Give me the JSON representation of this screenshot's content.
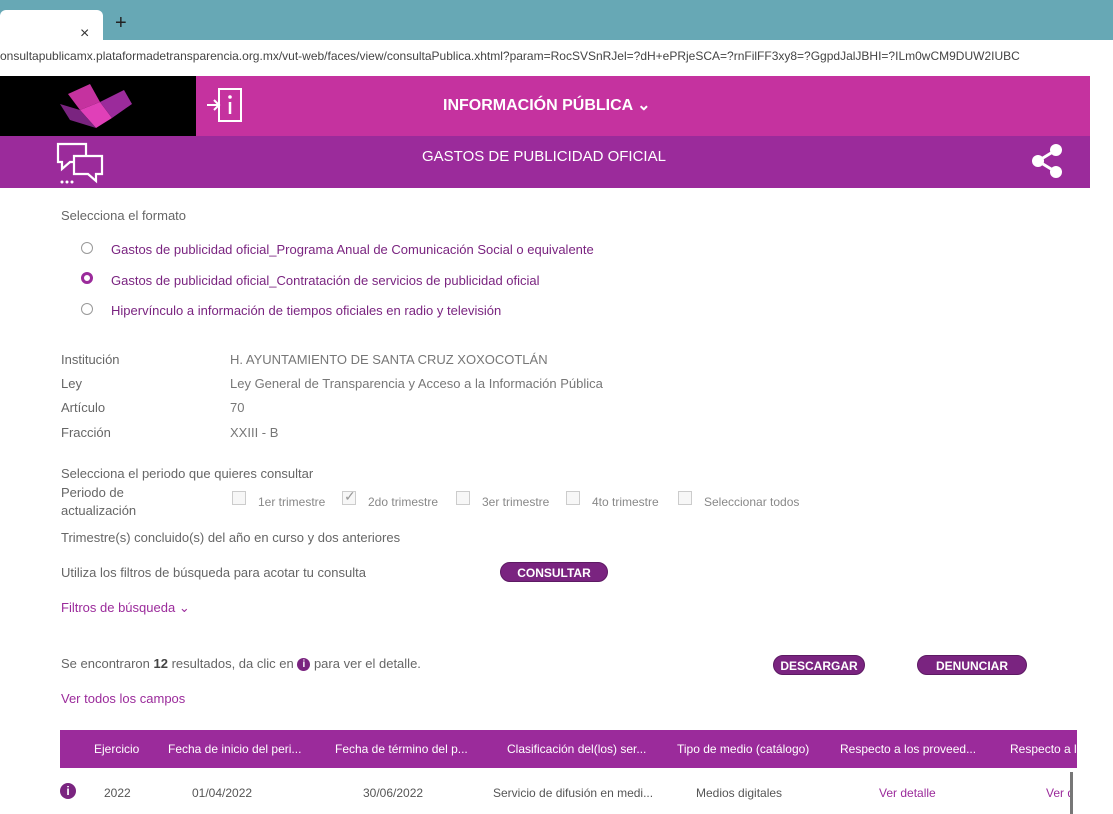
{
  "browser": {
    "tab_close": "×",
    "new_tab": "+",
    "url": "onsultapublicamx.plataformadetransparencia.org.mx/vut-web/faces/view/consultaPublica.xhtml?param=RocSVSnRJel=?dH+ePRjeSCA=?rnFilFF3xy8=?GgpdJalJBHI=?ILm0wCM9DUW2IUBC"
  },
  "header": {
    "title": "INFORMACIÓN PÚBLICA",
    "chevron": "⌄",
    "subtitle": "GASTOS DE PUBLICIDAD OFICIAL"
  },
  "format": {
    "label": "Selecciona el formato",
    "options": [
      {
        "label": "Gastos de publicidad oficial_Programa Anual de Comunicación Social o equivalente",
        "selected": false
      },
      {
        "label": "Gastos de publicidad oficial_Contratación de servicios de publicidad oficial",
        "selected": true
      },
      {
        "label": "Hipervínculo a información de tiempos oficiales en radio y televisión",
        "selected": false
      }
    ]
  },
  "info": {
    "institucion_key": "Institución",
    "institucion_val": "H. AYUNTAMIENTO DE SANTA CRUZ XOXOCOTLÁN",
    "ley_key": "Ley",
    "ley_val": "Ley General de Transparencia y Acceso a la Información Pública",
    "articulo_key": "Artículo",
    "articulo_val": "70",
    "fraccion_key": "Fracción",
    "fraccion_val": "XXIII - B"
  },
  "periodo": {
    "prompt": "Selecciona el periodo que quieres consultar",
    "label_line1": "Periodo de",
    "label_line2": "actualización",
    "options": [
      {
        "label": "1er trimestre",
        "checked": false
      },
      {
        "label": "2do trimestre",
        "checked": true
      },
      {
        "label": "3er trimestre",
        "checked": false
      },
      {
        "label": "4to trimestre",
        "checked": false
      },
      {
        "label": "Seleccionar todos",
        "checked": false
      }
    ],
    "note": "Trimestre(s) concluido(s) del año en curso y dos anteriores",
    "check_mark": "✓"
  },
  "search": {
    "hint": "Utiliza los filtros de búsqueda para acotar tu consulta",
    "consultar": "CONSULTAR",
    "filters": "Filtros de búsqueda"
  },
  "results": {
    "text_before": "Se encontraron ",
    "count": "12",
    "text_middle": " resultados, da clic en ",
    "info_glyph": "i",
    "text_after": " para ver el detalle.",
    "descargar": "DESCARGAR",
    "denunciar": "DENUNCIAR",
    "ver_todos": "Ver todos los campos"
  },
  "table": {
    "headers": [
      "Ejercicio",
      "Fecha de inicio del peri...",
      "Fecha de término del p...",
      "Clasificación del(los) ser...",
      "Tipo de medio (catálogo)",
      "Respecto a los proveed...",
      "Respecto a l"
    ],
    "rows": [
      {
        "info": "i",
        "ejercicio": "2022",
        "inicio": "01/04/2022",
        "termino": "30/06/2022",
        "clasificacion": "Servicio de difusión en medi...",
        "tipo": "Medios digitales",
        "proveedores": "Ver detalle",
        "respecto": "Ver d"
      }
    ]
  },
  "colors": {
    "header_pink": "#c5329f",
    "header_purple": "#9b2b9b",
    "button_purple": "#7a2480",
    "tab_teal": "#67a8b5"
  }
}
